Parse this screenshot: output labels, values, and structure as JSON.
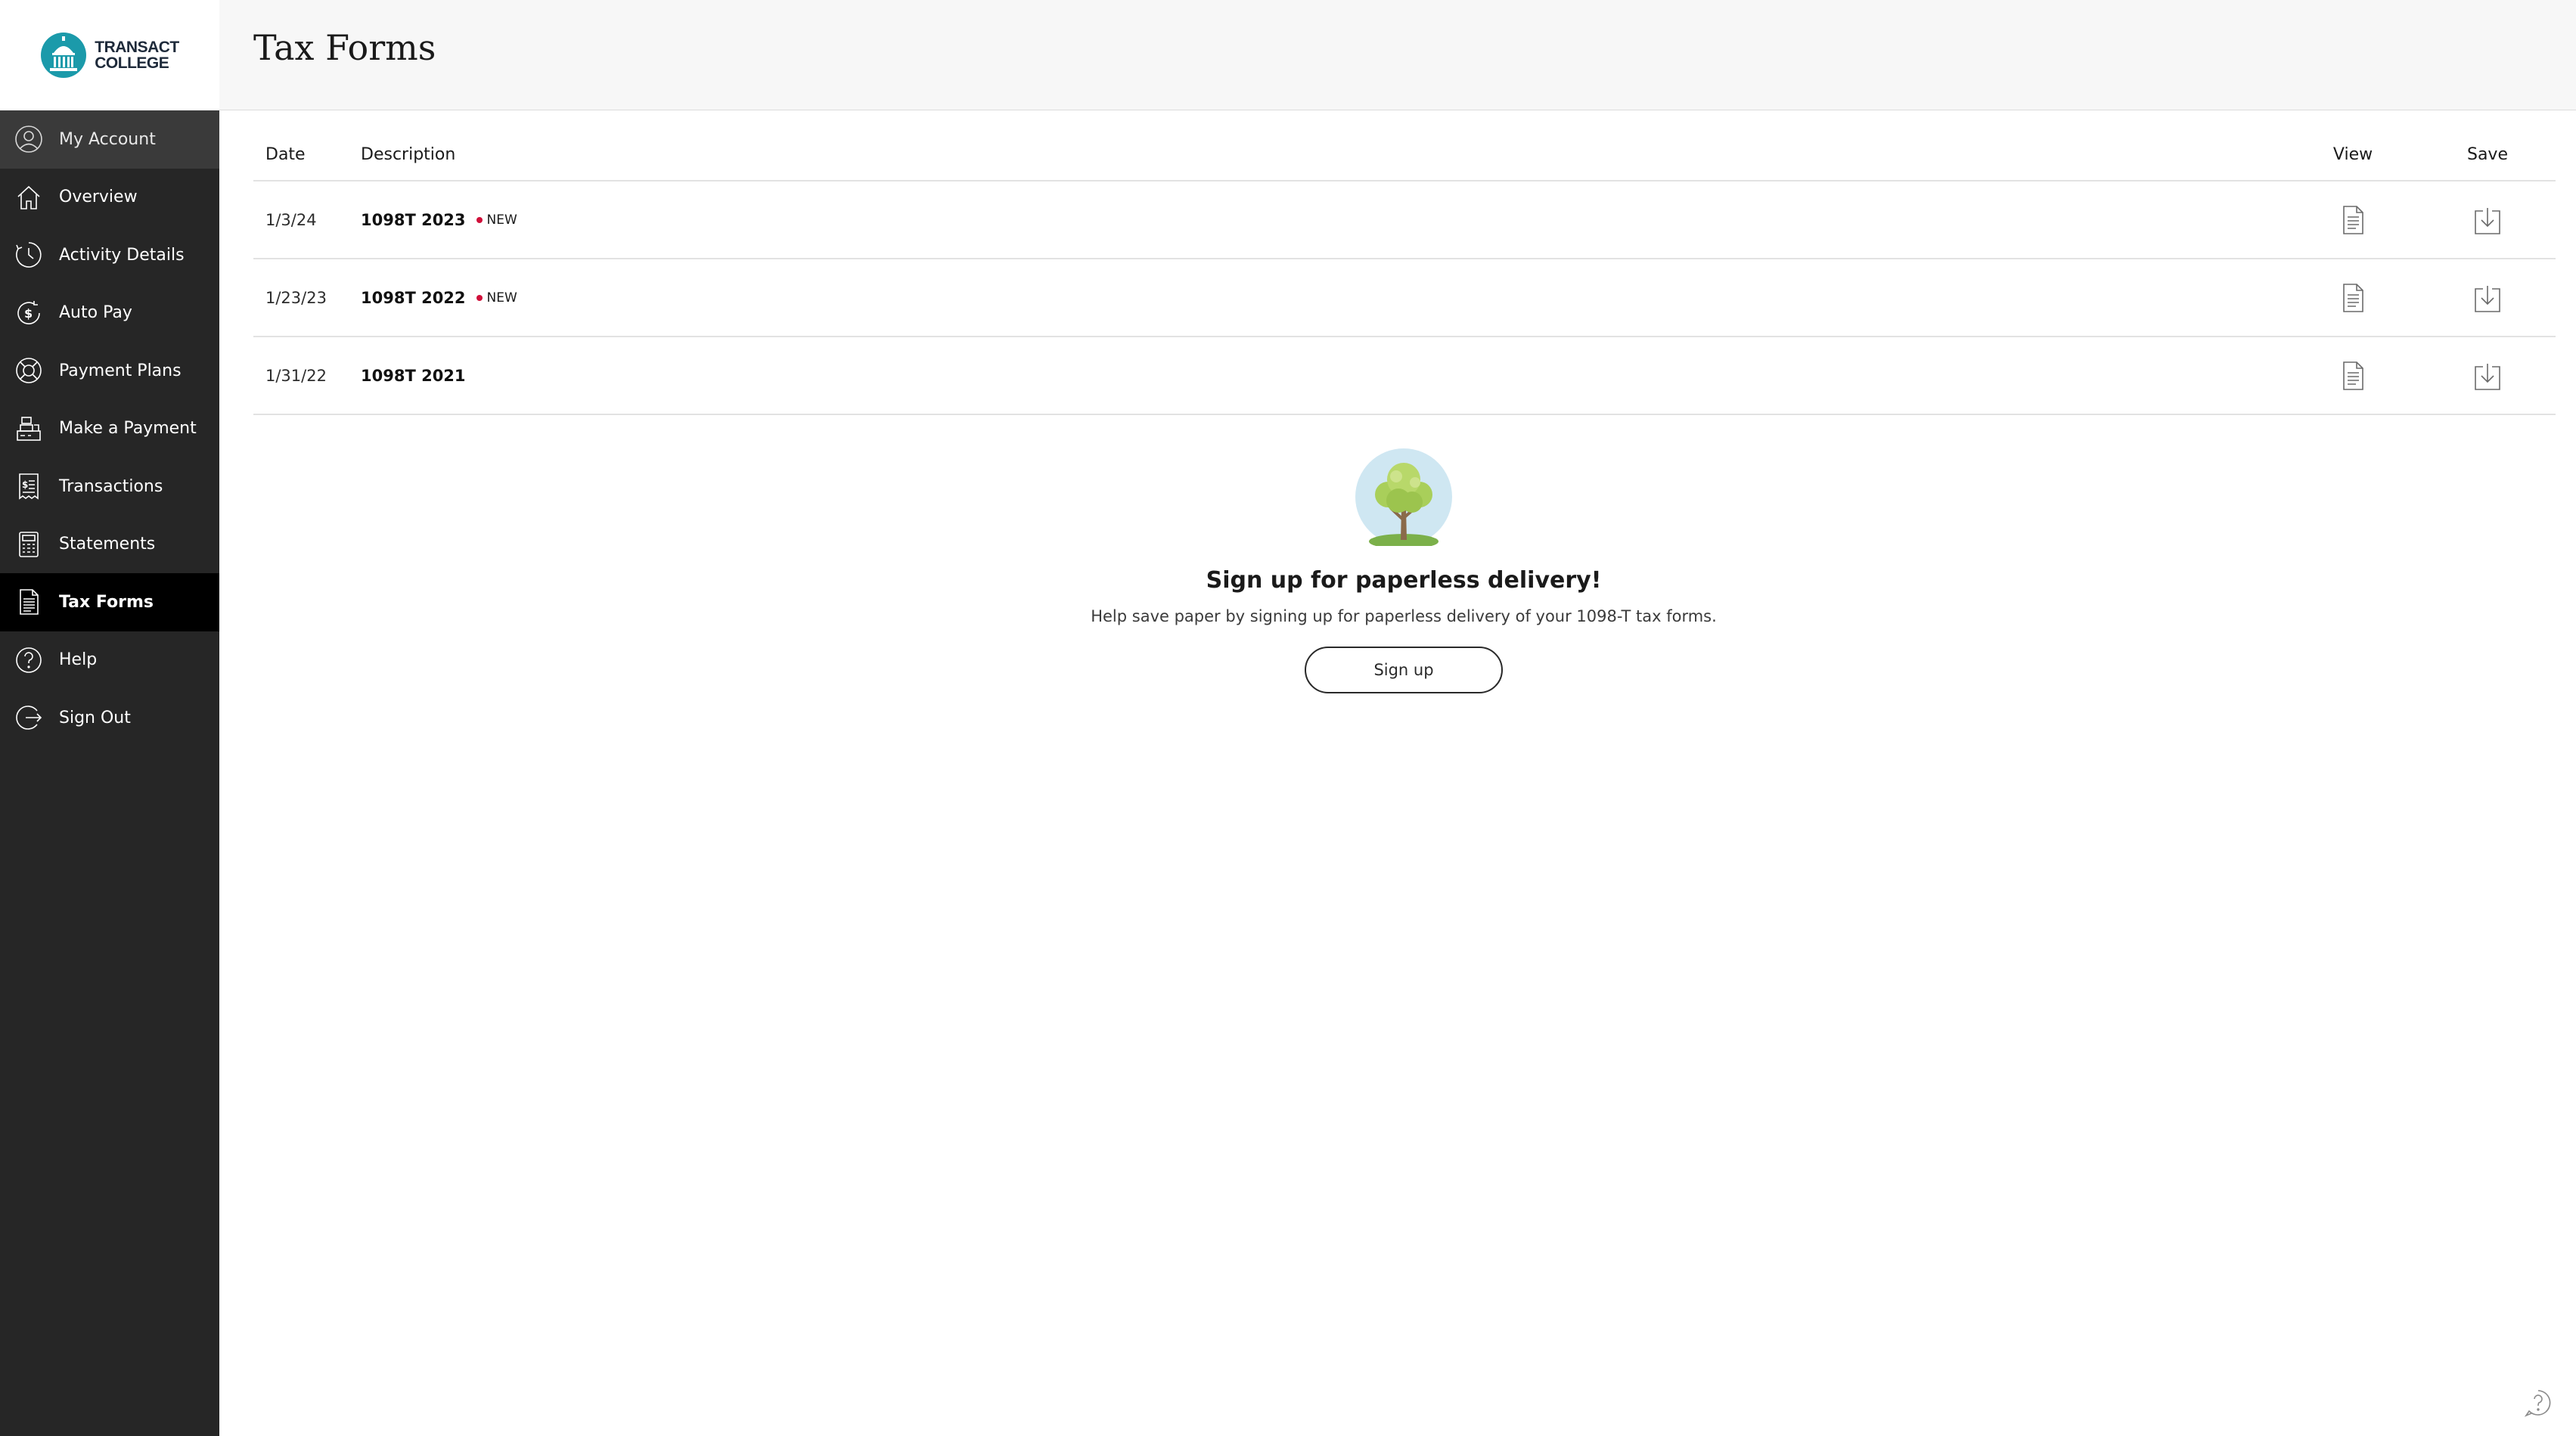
{
  "brand": {
    "line1": "TRANSACT",
    "line2": "COLLEGE",
    "color": "#1b9aaa"
  },
  "sidebar": {
    "items": [
      {
        "label": "My Account",
        "icon": "user-icon"
      },
      {
        "label": "Overview",
        "icon": "home-icon"
      },
      {
        "label": "Activity Details",
        "icon": "clock-icon"
      },
      {
        "label": "Auto Pay",
        "icon": "dollar-cycle-icon"
      },
      {
        "label": "Payment Plans",
        "icon": "lifebuoy-icon"
      },
      {
        "label": "Make a Payment",
        "icon": "register-icon"
      },
      {
        "label": "Transactions",
        "icon": "receipt-icon"
      },
      {
        "label": "Statements",
        "icon": "calculator-icon"
      },
      {
        "label": "Tax Forms",
        "icon": "document-icon"
      },
      {
        "label": "Help",
        "icon": "question-icon"
      },
      {
        "label": "Sign Out",
        "icon": "sign-out-icon"
      }
    ],
    "active_index": 8
  },
  "header": {
    "title": "Tax Forms"
  },
  "table": {
    "columns": {
      "date": "Date",
      "description": "Description",
      "view": "View",
      "save": "Save"
    },
    "rows": [
      {
        "date": "1/3/24",
        "description": "1098T 2023",
        "badge": "NEW"
      },
      {
        "date": "1/23/23",
        "description": "1098T 2022",
        "badge": "NEW"
      },
      {
        "date": "1/31/22",
        "description": "1098T 2021",
        "badge": ""
      }
    ]
  },
  "promo": {
    "title": "Sign up for paperless delivery!",
    "text": "Help save paper by signing up for paperless delivery of your 1098-T tax forms.",
    "button_label": "Sign up",
    "icon": "tree-icon"
  },
  "colors": {
    "sidebar_bg": "#262626",
    "active_bg": "#000000",
    "new_dot": "#d0103a"
  }
}
